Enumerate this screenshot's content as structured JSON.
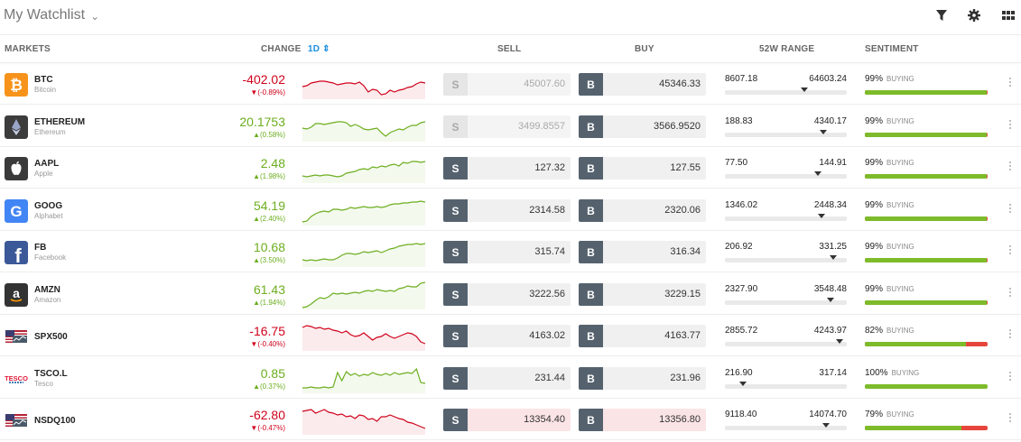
{
  "toolbar": {
    "title": "My Watchlist",
    "icons": [
      "filter-icon",
      "gear-icon",
      "grid-view-icon"
    ]
  },
  "columns": {
    "markets": "MARKETS",
    "change": "CHANGE",
    "period": "1D",
    "sell": "SELL",
    "buy": "BUY",
    "range": "52W RANGE",
    "sentiment": "SENTIMENT"
  },
  "colors": {
    "up": "#6cae1f",
    "down": "#d0021b",
    "accent": "#1a8fe3",
    "button": "#55626e",
    "sentiment_buy": "#7dbb2a",
    "sentiment_sell": "#e6453c"
  },
  "sell_label": "S",
  "buy_label": "B",
  "buying_label": "BUYING",
  "rows": [
    {
      "symbol": "BTC",
      "name": "Bitcoin",
      "logo": "bitcoin-logo",
      "change": "-402.02",
      "change_pct": "(-0.89%)",
      "direction": "down",
      "sell": "45007.60",
      "buy": "45346.33",
      "sell_state": "disabled",
      "range_low": "8607.18",
      "range_high": "64603.24",
      "range_position": 0.65,
      "sentiment_pct": "99%",
      "sentiment_value": 0.99,
      "spark": [
        18,
        17,
        14,
        13,
        12,
        12,
        13,
        14,
        16,
        15,
        14,
        14,
        15,
        13,
        17,
        24,
        21,
        22,
        27,
        26,
        22,
        24,
        22,
        21,
        19,
        18,
        15,
        13,
        14
      ]
    },
    {
      "symbol": "ETHEREUM",
      "name": "Ethereum",
      "logo": "ethereum-logo",
      "change": "20.1753",
      "change_pct": "(0.58%)",
      "direction": "up",
      "sell": "3499.8557",
      "buy": "3566.9520",
      "sell_state": "disabled",
      "range_low": "188.83",
      "range_high": "4340.17",
      "range_position": 0.81,
      "sentiment_pct": "99%",
      "sentiment_value": 0.99,
      "spark": [
        17,
        18,
        16,
        12,
        12,
        13,
        12,
        11,
        10,
        10,
        11,
        15,
        13,
        15,
        18,
        19,
        18,
        17,
        22,
        26,
        22,
        20,
        18,
        19,
        16,
        14,
        14,
        11,
        10
      ]
    },
    {
      "symbol": "AAPL",
      "name": "Apple",
      "logo": "apple-logo",
      "change": "2.48",
      "change_pct": "(1.98%)",
      "direction": "up",
      "sell": "127.32",
      "buy": "127.55",
      "sell_state": "normal",
      "range_low": "77.50",
      "range_high": "144.91",
      "range_position": 0.76,
      "sentiment_pct": "99%",
      "sentiment_value": 0.99,
      "spark": [
        24,
        25,
        24,
        23,
        24,
        23,
        23,
        24,
        25,
        24,
        21,
        20,
        19,
        17,
        16,
        17,
        14,
        15,
        13,
        14,
        12,
        11,
        13,
        9,
        10,
        8,
        8,
        9,
        8
      ]
    },
    {
      "symbol": "GOOG",
      "name": "Alphabet",
      "logo": "google-logo",
      "change": "54.19",
      "change_pct": "(2.40%)",
      "direction": "up",
      "sell": "2314.58",
      "buy": "2320.06",
      "sell_state": "normal",
      "range_low": "1346.02",
      "range_high": "2448.34",
      "range_position": 0.79,
      "sentiment_pct": "99%",
      "sentiment_value": 0.99,
      "spark": [
        28,
        27,
        22,
        19,
        17,
        16,
        17,
        14,
        14,
        15,
        14,
        12,
        13,
        12,
        11,
        12,
        12,
        11,
        12,
        11,
        9,
        8,
        8,
        7,
        7,
        6,
        6,
        5,
        6
      ]
    },
    {
      "symbol": "FB",
      "name": "Facebook",
      "logo": "facebook-logo",
      "change": "10.68",
      "change_pct": "(3.50%)",
      "direction": "up",
      "sell": "315.74",
      "buy": "316.34",
      "sell_state": "normal",
      "range_low": "206.92",
      "range_high": "331.25",
      "range_position": 0.89,
      "sentiment_pct": "99%",
      "sentiment_value": 0.99,
      "spark": [
        24,
        25,
        24,
        25,
        24,
        23,
        24,
        24,
        22,
        19,
        17,
        17,
        18,
        17,
        15,
        16,
        15,
        14,
        16,
        14,
        12,
        11,
        9,
        8,
        7,
        7,
        6,
        7,
        6
      ]
    },
    {
      "symbol": "AMZN",
      "name": "Amazon",
      "logo": "amazon-logo",
      "change": "61.43",
      "change_pct": "(1.94%)",
      "direction": "up",
      "sell": "3222.56",
      "buy": "3229.15",
      "sell_state": "normal",
      "range_low": "2327.90",
      "range_high": "3548.48",
      "range_position": 0.87,
      "sentiment_pct": "99%",
      "sentiment_value": 0.99,
      "spark": [
        30,
        29,
        26,
        22,
        19,
        20,
        18,
        14,
        15,
        14,
        15,
        14,
        13,
        14,
        12,
        11,
        12,
        10,
        11,
        12,
        11,
        12,
        9,
        8,
        6,
        7,
        7,
        3,
        2
      ]
    },
    {
      "symbol": "SPX500",
      "name": "",
      "logo": "spx500-logo",
      "change": "-16.75",
      "change_pct": "(-0.40%)",
      "direction": "down",
      "sell": "4163.02",
      "buy": "4163.77",
      "sell_state": "normal",
      "range_low": "2855.72",
      "range_high": "4243.97",
      "range_position": 0.94,
      "sentiment_pct": "82%",
      "sentiment_value": 0.82,
      "spark": [
        6,
        4,
        5,
        7,
        6,
        8,
        7,
        9,
        10,
        12,
        10,
        14,
        16,
        15,
        12,
        16,
        20,
        17,
        16,
        13,
        16,
        18,
        16,
        14,
        12,
        13,
        16,
        22,
        24
      ]
    },
    {
      "symbol": "TSCO.L",
      "name": "Tesco",
      "logo": "tesco-logo",
      "change": "0.85",
      "change_pct": "(0.37%)",
      "direction": "up",
      "sell": "231.44",
      "buy": "231.96",
      "sell_state": "normal",
      "range_low": "216.90",
      "range_high": "317.14",
      "range_position": 0.15,
      "sentiment_pct": "100%",
      "sentiment_value": 1.0,
      "spark": [
        26,
        26,
        25,
        26,
        26,
        25,
        26,
        25,
        9,
        18,
        8,
        12,
        10,
        13,
        11,
        12,
        9,
        11,
        12,
        10,
        12,
        9,
        11,
        10,
        9,
        10,
        5,
        20,
        21
      ]
    },
    {
      "symbol": "NSDQ100",
      "name": "",
      "logo": "nasdaq-logo",
      "change": "-62.80",
      "change_pct": "(-0.47%)",
      "direction": "down",
      "sell": "13354.40",
      "buy": "13356.80",
      "sell_state": "pink",
      "range_low": "9118.40",
      "range_high": "14074.70",
      "range_position": 0.83,
      "sentiment_pct": "79%",
      "sentiment_value": 0.79,
      "spark": [
        6,
        5,
        4,
        8,
        6,
        4,
        7,
        8,
        10,
        9,
        12,
        11,
        14,
        10,
        11,
        15,
        14,
        17,
        12,
        12,
        10,
        12,
        14,
        15,
        18,
        19,
        21,
        23,
        25
      ]
    }
  ]
}
